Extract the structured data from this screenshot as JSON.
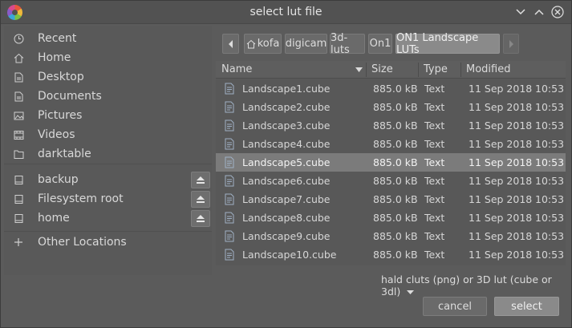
{
  "window": {
    "title": "select lut file"
  },
  "sidebar": {
    "places": [
      {
        "label": "Recent",
        "icon": "clock-icon"
      },
      {
        "label": "Home",
        "icon": "home-icon"
      },
      {
        "label": "Desktop",
        "icon": "folder-icon"
      },
      {
        "label": "Documents",
        "icon": "folder-icon"
      },
      {
        "label": "Pictures",
        "icon": "image-icon"
      },
      {
        "label": "Videos",
        "icon": "film-icon"
      },
      {
        "label": "darktable",
        "icon": "folder-icon"
      }
    ],
    "devices": [
      {
        "label": "backup",
        "icon": "drive-icon"
      },
      {
        "label": "Filesystem root",
        "icon": "drive-icon"
      },
      {
        "label": "home",
        "icon": "drive-icon"
      }
    ],
    "other": {
      "label": "Other Locations",
      "icon": "plus-icon"
    }
  },
  "pathbar": {
    "crumbs": [
      "kofa",
      "digicam",
      "3d-luts",
      "On1",
      "ON1 Landscape LUTs"
    ],
    "active_index": 4
  },
  "filelist": {
    "columns": {
      "name": "Name",
      "size": "Size",
      "type": "Type",
      "modified": "Modified"
    },
    "rows": [
      {
        "name": "Landscape1.cube",
        "size": "885.0 kB",
        "type": "Text",
        "date": "11 Sep 2018",
        "time": "10:53"
      },
      {
        "name": "Landscape2.cube",
        "size": "885.0 kB",
        "type": "Text",
        "date": "11 Sep 2018",
        "time": "10:53"
      },
      {
        "name": "Landscape3.cube",
        "size": "885.0 kB",
        "type": "Text",
        "date": "11 Sep 2018",
        "time": "10:53"
      },
      {
        "name": "Landscape4.cube",
        "size": "885.0 kB",
        "type": "Text",
        "date": "11 Sep 2018",
        "time": "10:53"
      },
      {
        "name": "Landscape5.cube",
        "size": "885.0 kB",
        "type": "Text",
        "date": "11 Sep 2018",
        "time": "10:53"
      },
      {
        "name": "Landscape6.cube",
        "size": "885.0 kB",
        "type": "Text",
        "date": "11 Sep 2018",
        "time": "10:53"
      },
      {
        "name": "Landscape7.cube",
        "size": "885.0 kB",
        "type": "Text",
        "date": "11 Sep 2018",
        "time": "10:53"
      },
      {
        "name": "Landscape8.cube",
        "size": "885.0 kB",
        "type": "Text",
        "date": "11 Sep 2018",
        "time": "10:53"
      },
      {
        "name": "Landscape9.cube",
        "size": "885.0 kB",
        "type": "Text",
        "date": "11 Sep 2018",
        "time": "10:53"
      },
      {
        "name": "Landscape10.cube",
        "size": "885.0 kB",
        "type": "Text",
        "date": "11 Sep 2018",
        "time": "10:53"
      }
    ],
    "selected_index": 4
  },
  "filter": {
    "label": "hald cluts (png) or 3D lut (cube or 3dl)"
  },
  "buttons": {
    "cancel": "cancel",
    "select": "select"
  }
}
